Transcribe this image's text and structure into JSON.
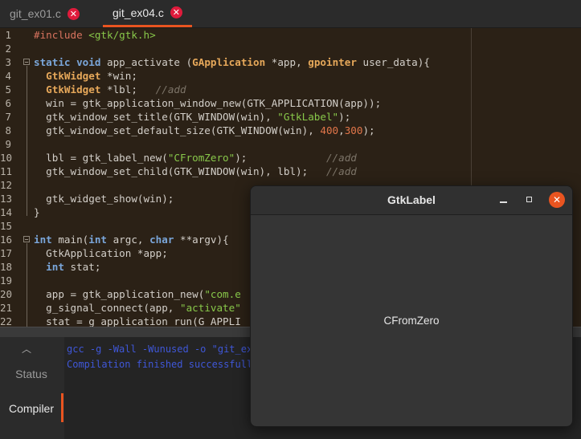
{
  "tabs": [
    {
      "label": "git_ex01.c",
      "active": false
    },
    {
      "label": "git_ex04.c",
      "active": true
    }
  ],
  "editor": {
    "lines": [
      {
        "n": "1",
        "html": "<span class=\"pp\">#include</span> <span class=\"ppinc\">&lt;gtk/gtk.h&gt;</span>"
      },
      {
        "n": "2",
        "html": ""
      },
      {
        "n": "3",
        "fold": "-",
        "html": "<span class=\"kw\">static</span> <span class=\"kw\">void</span> app_activate (<span class=\"ty\">GApplication</span> *app, <span class=\"ty\">gpointer</span> user_data){"
      },
      {
        "n": "4",
        "html": "  <span class=\"ty\">GtkWidget</span> *win;"
      },
      {
        "n": "5",
        "html": "  <span class=\"ty\">GtkWidget</span> *lbl;   <span class=\"cm\">//add</span>"
      },
      {
        "n": "6",
        "html": "  win = gtk_application_window_new(GTK_APPLICATION(app));"
      },
      {
        "n": "7",
        "html": "  gtk_window_set_title(GTK_WINDOW(win), <span class=\"str\">\"GtkLabel\"</span>);"
      },
      {
        "n": "8",
        "html": "  gtk_window_set_default_size(GTK_WINDOW(win), <span class=\"num\">400</span>,<span class=\"num\">300</span>);"
      },
      {
        "n": "9",
        "html": ""
      },
      {
        "n": "10",
        "html": "  lbl = gtk_label_new(<span class=\"str\">\"CFromZero\"</span>);             <span class=\"cm\">//add</span>"
      },
      {
        "n": "11",
        "html": "  gtk_window_set_child(GTK_WINDOW(win), lbl);   <span class=\"cm\">//add</span>"
      },
      {
        "n": "12",
        "html": ""
      },
      {
        "n": "13",
        "html": "  gtk_widget_show(win);"
      },
      {
        "n": "14",
        "html": "}"
      },
      {
        "n": "15",
        "html": ""
      },
      {
        "n": "16",
        "fold": "-",
        "html": "<span class=\"kw\">int</span> main(<span class=\"kw\">int</span> argc, <span class=\"kw\">char</span> **argv){"
      },
      {
        "n": "17",
        "html": "  GtkApplication *app;"
      },
      {
        "n": "18",
        "html": "  <span class=\"kw\">int</span> stat;"
      },
      {
        "n": "19",
        "html": ""
      },
      {
        "n": "20",
        "html": "  app = gtk_application_new(<span class=\"str\">\"com.e</span>"
      },
      {
        "n": "21",
        "html": "  g_signal_connect(app, <span class=\"str\">\"activate\"</span>"
      },
      {
        "n": "22",
        "html": "  stat = g_application_run(G_APPLI"
      }
    ]
  },
  "bottom_panel": {
    "tabs": [
      {
        "label": "Status",
        "active": false
      },
      {
        "label": "Compiler",
        "active": true
      }
    ],
    "output": [
      "gcc -g -Wall -Wunused -o \"git_ex",
      "Compilation finished successfully"
    ]
  },
  "gtk_window": {
    "title": "GtkLabel",
    "label_text": "CFromZero"
  },
  "colors": {
    "accent": "#e95420",
    "tab_close": "#e01b3c",
    "editor_bg": "#2b2116"
  }
}
